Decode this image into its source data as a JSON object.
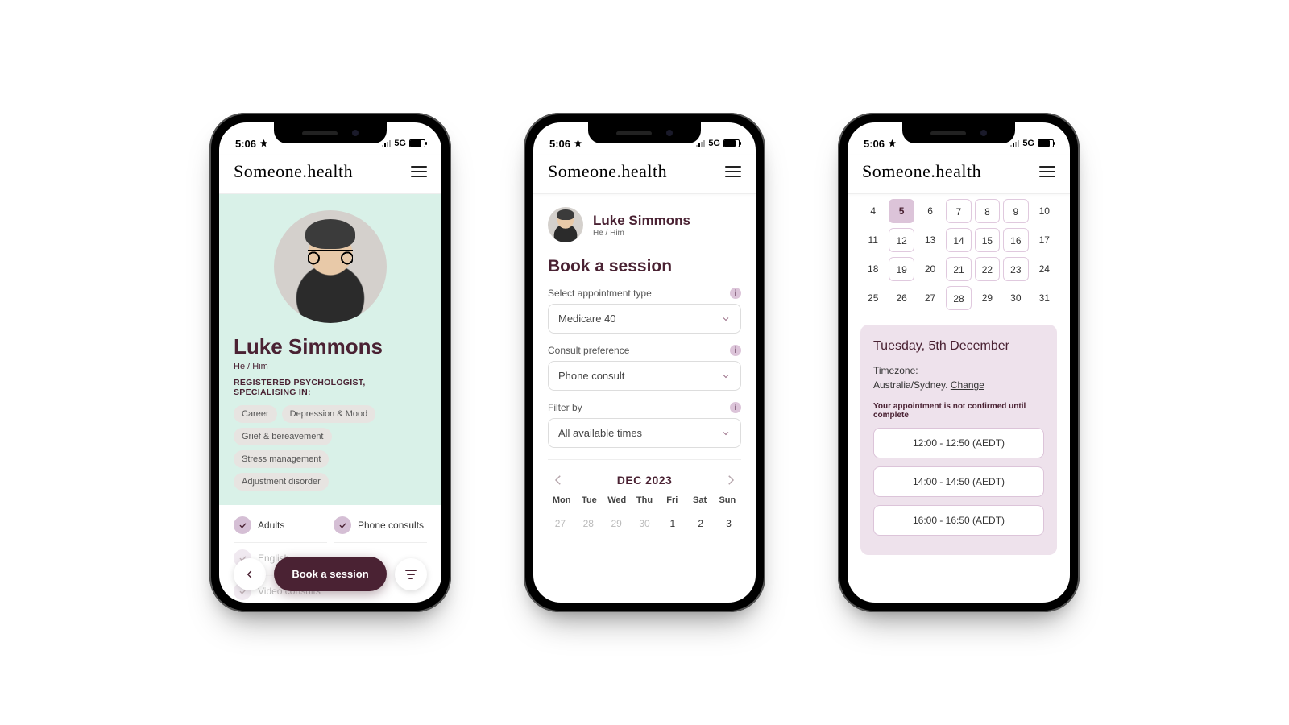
{
  "status": {
    "time": "5:06",
    "network": "5G"
  },
  "brand": {
    "logo_text": "Someone.health"
  },
  "profile": {
    "name": "Luke Simmons",
    "pronouns": "He / Him",
    "role_line": "REGISTERED PSYCHOLOGIST, SPECIALISING IN:",
    "specialties": [
      "Career",
      "Depression & Mood",
      "Grief & bereavement",
      "Stress management",
      "Adjustment disorder"
    ],
    "features": {
      "adults": "Adults",
      "phone_consults": "Phone consults",
      "video_consults": "Video consults",
      "languages": "English, ..."
    },
    "book_cta": "Book a session"
  },
  "booking": {
    "heading": "Book a session",
    "appt_type": {
      "label": "Select appointment type",
      "value": "Medicare 40"
    },
    "consult_pref": {
      "label": "Consult preference",
      "value": "Phone consult"
    },
    "filter": {
      "label": "Filter by",
      "value": "All available times"
    },
    "calendar": {
      "month_label": "DEC 2023",
      "dow": [
        "Mon",
        "Tue",
        "Wed",
        "Thu",
        "Fri",
        "Sat",
        "Sun"
      ],
      "week0": [
        "27",
        "28",
        "29",
        "30",
        "1",
        "2",
        "3"
      ]
    }
  },
  "calendar_full": {
    "rows": [
      [
        "4",
        "5",
        "6",
        "7",
        "8",
        "9",
        "10"
      ],
      [
        "11",
        "12",
        "13",
        "14",
        "15",
        "16",
        "17"
      ],
      [
        "18",
        "19",
        "20",
        "21",
        "22",
        "23",
        "24"
      ],
      [
        "25",
        "26",
        "27",
        "28",
        "29",
        "30",
        "31"
      ]
    ],
    "available": [
      "5",
      "7",
      "8",
      "9",
      "12",
      "14",
      "15",
      "16",
      "19",
      "21",
      "22",
      "23",
      "28"
    ],
    "selected": "5"
  },
  "slots": {
    "date_heading": "Tuesday, 5th December",
    "tz_label": "Timezone:",
    "tz_value": "Australia/Sydney.",
    "tz_change": "Change",
    "confirm_note": "Your appointment is not confirmed until complete",
    "times": [
      "12:00 - 12:50 (AEDT)",
      "14:00 - 14:50 (AEDT)",
      "16:00 - 16:50 (AEDT)"
    ]
  }
}
